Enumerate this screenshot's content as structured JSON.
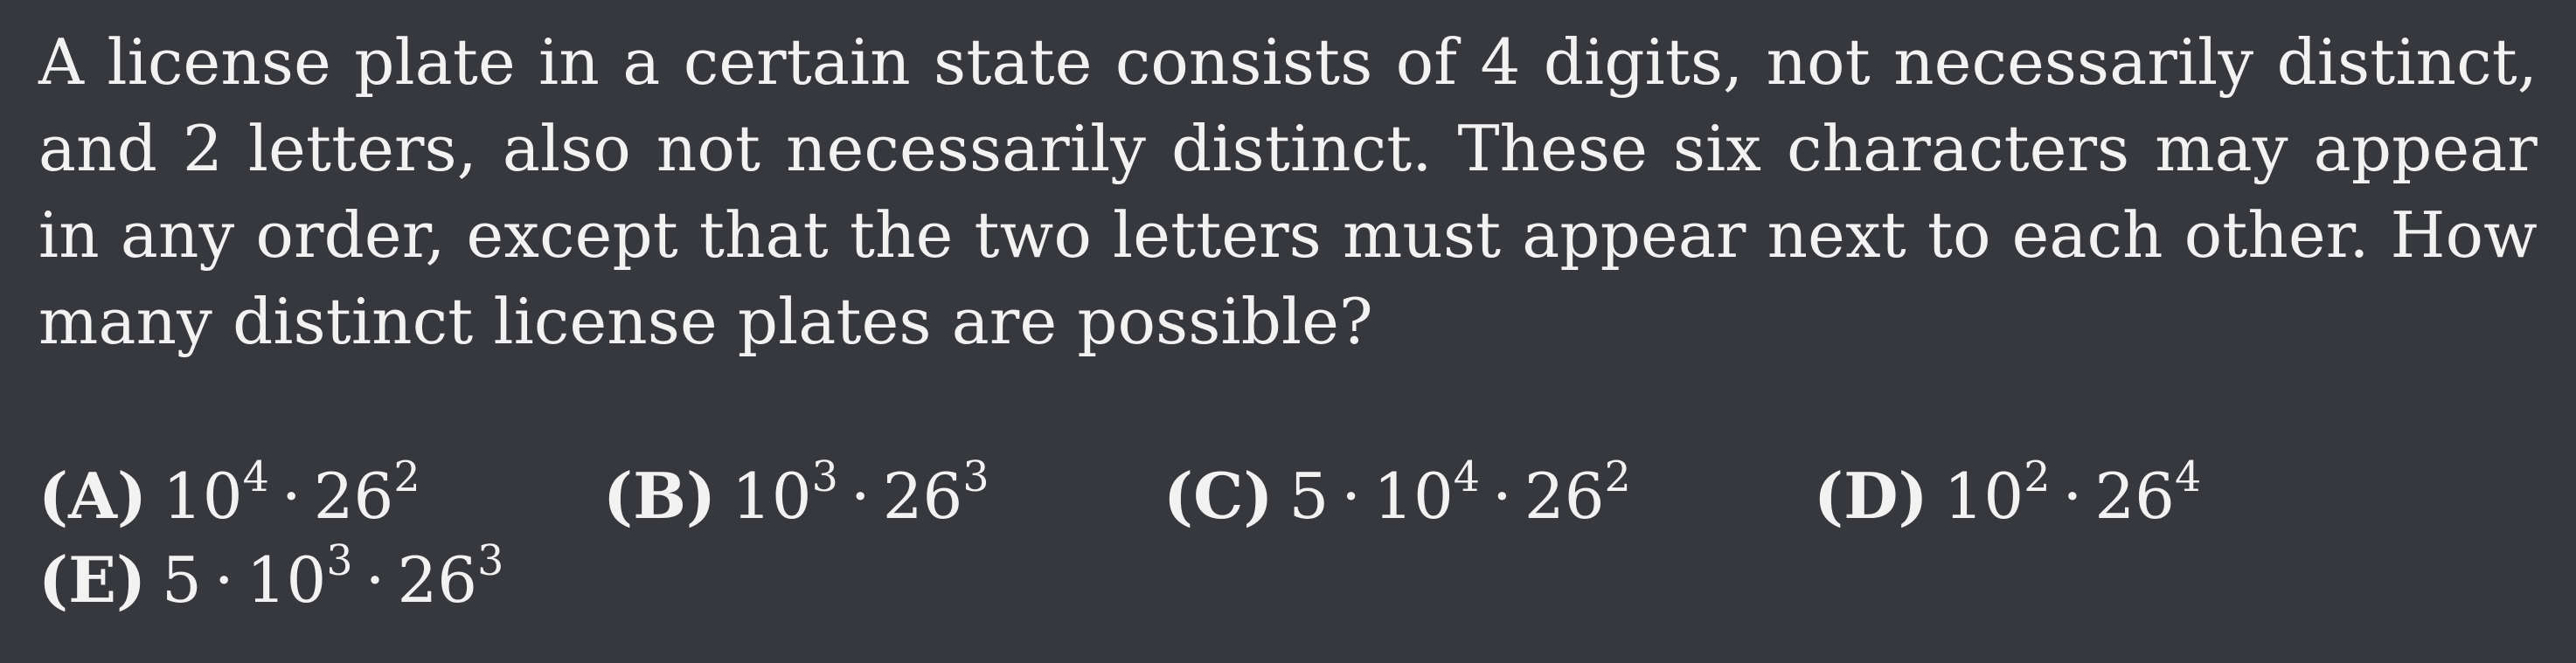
{
  "problem": {
    "text": "A license plate in a certain state consists of 4 digits, not necessarily distinct, and 2 letters, also not necessarily distinct. These six characters may appear in any order, except that the two letters must appear next to each other. How many distinct license plates are possible?"
  },
  "choices": [
    {
      "label": "(A)",
      "parts": [
        "10",
        "4",
        "26",
        "2"
      ]
    },
    {
      "label": "(B)",
      "parts": [
        "10",
        "3",
        "26",
        "3"
      ]
    },
    {
      "label": "(C)",
      "coef": "5",
      "parts": [
        "10",
        "4",
        "26",
        "2"
      ]
    },
    {
      "label": "(D)",
      "parts": [
        "10",
        "2",
        "26",
        "4"
      ]
    },
    {
      "label": "(E)",
      "coef": "5",
      "parts": [
        "10",
        "3",
        "26",
        "3"
      ]
    }
  ],
  "symbols": {
    "dot": "·"
  }
}
